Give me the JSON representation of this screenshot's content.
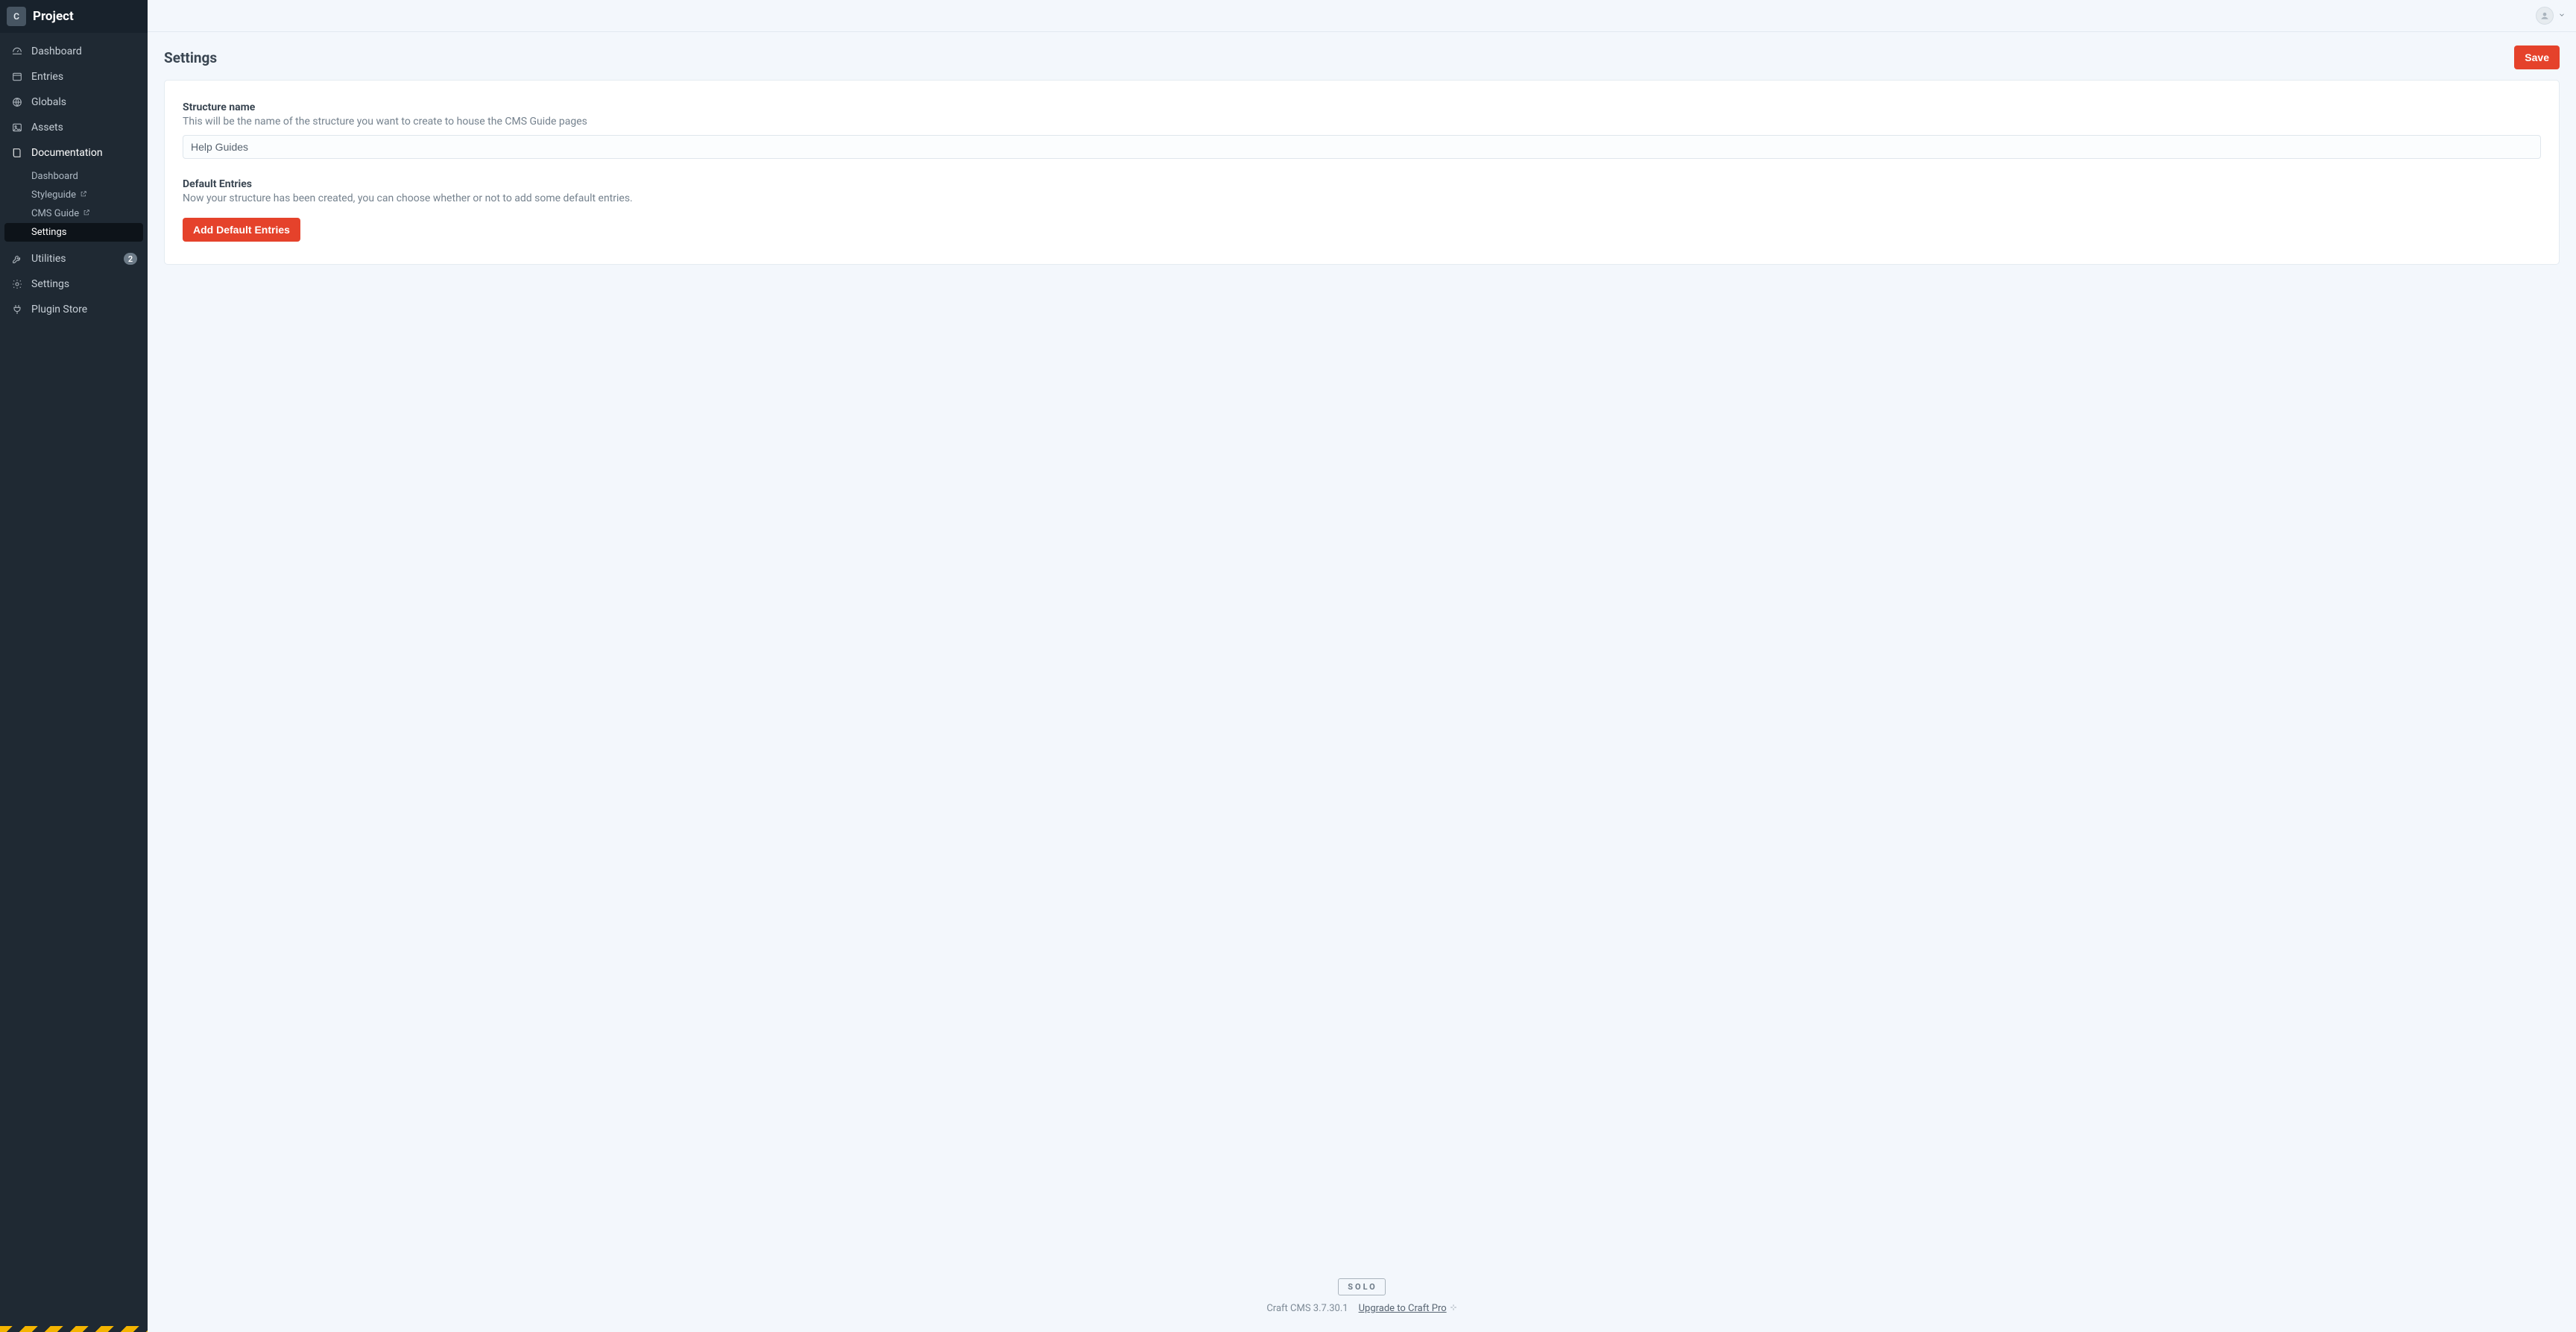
{
  "sidebar": {
    "site_initial": "C",
    "site_name": "Project",
    "items": [
      {
        "key": "dashboard",
        "label": "Dashboard",
        "icon": "dashboard-icon"
      },
      {
        "key": "entries",
        "label": "Entries",
        "icon": "entries-icon"
      },
      {
        "key": "globals",
        "label": "Globals",
        "icon": "globals-icon"
      },
      {
        "key": "assets",
        "label": "Assets",
        "icon": "assets-icon"
      },
      {
        "key": "documentation",
        "label": "Documentation",
        "icon": "book-icon",
        "active": true,
        "sub": [
          {
            "key": "doc-dashboard",
            "label": "Dashboard"
          },
          {
            "key": "doc-styleguide",
            "label": "Styleguide",
            "ext": true
          },
          {
            "key": "doc-cmsguide",
            "label": "CMS Guide",
            "ext": true
          },
          {
            "key": "doc-settings",
            "label": "Settings",
            "active": true
          }
        ]
      },
      {
        "key": "utilities",
        "label": "Utilities",
        "icon": "wrench-icon",
        "badge": "2"
      },
      {
        "key": "settings",
        "label": "Settings",
        "icon": "gear-icon"
      },
      {
        "key": "plugin-store",
        "label": "Plugin Store",
        "icon": "plug-icon"
      }
    ]
  },
  "header": {
    "page_title": "Settings",
    "save_label": "Save"
  },
  "form": {
    "structure_name_label": "Structure name",
    "structure_name_help": "This will be the name of the structure you want to create to house the CMS Guide pages",
    "structure_name_value": "Help Guides",
    "default_entries_label": "Default Entries",
    "default_entries_help": "Now your structure has been created, you can choose whether or not to add some default entries.",
    "add_default_entries_label": "Add Default Entries"
  },
  "footer": {
    "edition": "SOLO",
    "product": "Craft CMS 3.7.30.1",
    "upgrade_label": "Upgrade to Craft Pro"
  }
}
